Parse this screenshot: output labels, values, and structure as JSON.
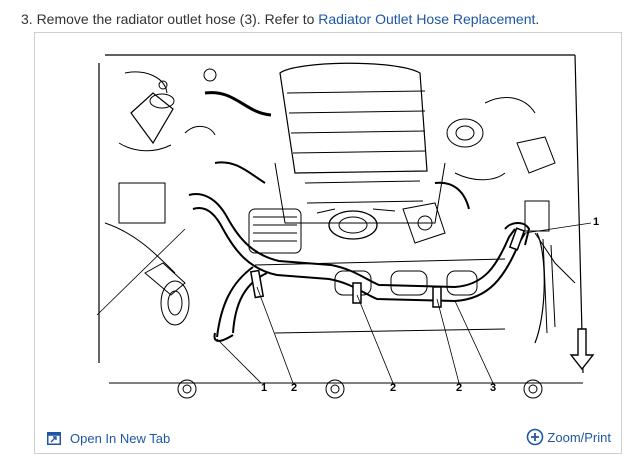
{
  "step": {
    "text": "3. Remove the radiator outlet hose (3). Refer to ",
    "link": "Radiator Outlet Hose Replacement",
    "end": "."
  },
  "figure": {
    "callouts": [
      "1",
      "2",
      "2",
      "2",
      "3",
      "1"
    ]
  },
  "footer": {
    "open_tab_label": "Open In New Tab",
    "zoom_label": "Zoom/Print"
  },
  "colors": {
    "link": "#1f57a4",
    "text": "#333333",
    "border": "#cfcfcf"
  },
  "icons": [
    "open-in-new-tab-icon",
    "zoom-plus-icon",
    "down-arrow-icon"
  ]
}
